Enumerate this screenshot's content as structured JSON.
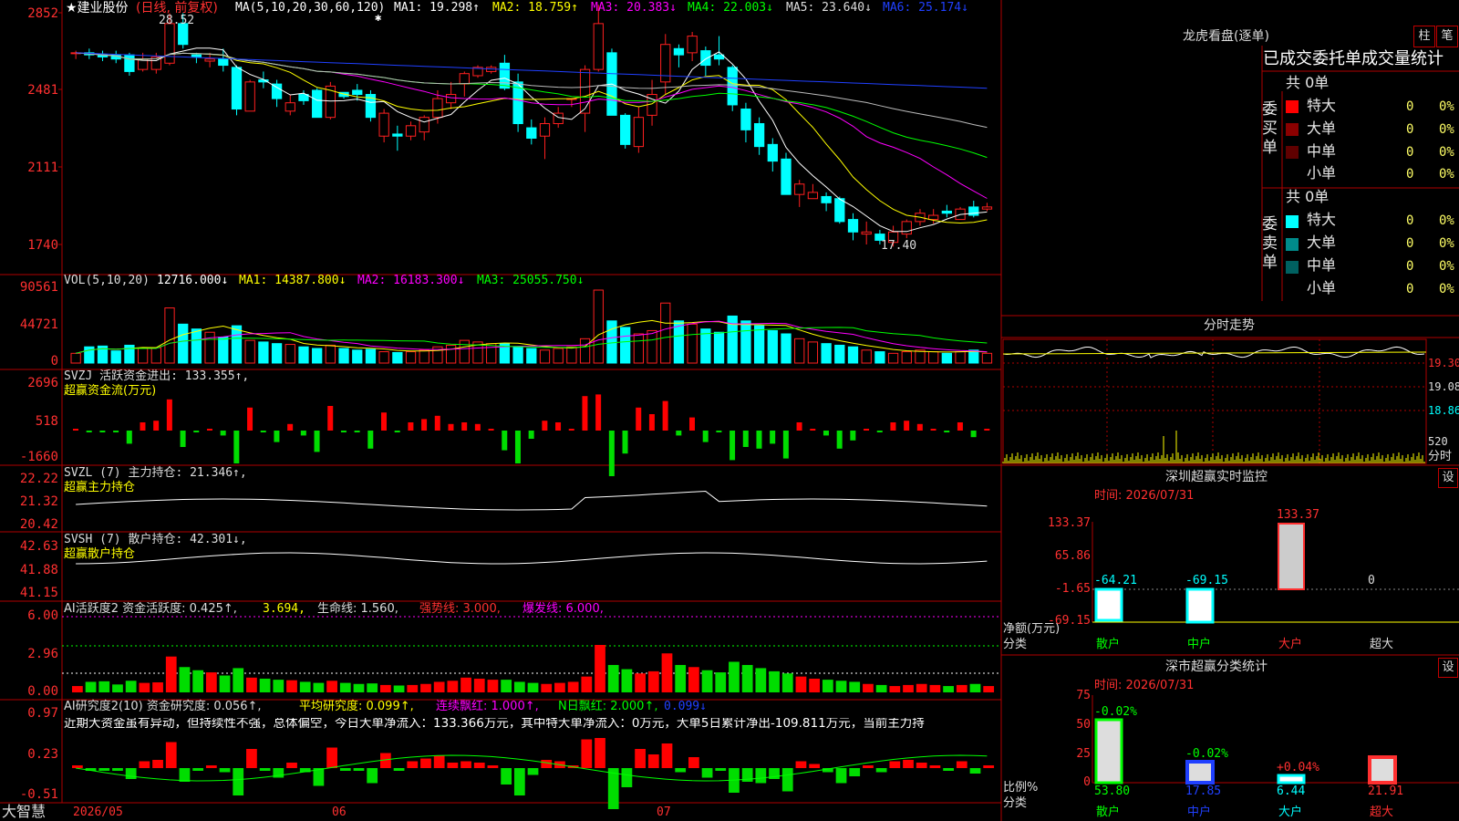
{
  "colors": {
    "up": "#ff2020",
    "down": "#00ffff",
    "ma1": "#ffffff",
    "ma2": "#ffff00",
    "ma3": "#ff00ff",
    "ma4": "#00ff00",
    "ma5": "#bbbbbb",
    "ma6": "#2040ff",
    "grid": "#b00000"
  },
  "header": {
    "title": "★建业股份",
    "mode": "(日线, 前复权)",
    "ma_label": "MA(5,10,20,30,60,120)",
    "ma": [
      "MA1: 19.298↑",
      "MA2: 18.759↑",
      "MA3: 20.383↓",
      "MA4: 22.003↓",
      "MA5: 23.640↓",
      "MA6: 25.174↓"
    ]
  },
  "price_axis": [
    "2852",
    "2481",
    "2111",
    "1740"
  ],
  "price_notes": {
    "high": "28.52",
    "low": "17.40",
    "star": "✱"
  },
  "vol": {
    "label": "VOL(5,10,20)",
    "value": "12716.000↓",
    "ma": [
      "MA1: 14387.800↓",
      "MA2: 16183.300↓",
      "MA3: 25055.750↓"
    ],
    "axis": [
      "90561",
      "44721",
      "0"
    ]
  },
  "svzj": {
    "label": "SVZJ  活跃资金进出: 133.355↑,",
    "sub": "超赢资金流(万元)",
    "axis": [
      "2696",
      "518",
      "-1660"
    ]
  },
  "svzl": {
    "label": "SVZL (7) 主力持仓: 21.346↑,",
    "sub": "超赢主力持仓",
    "axis": [
      "22.22",
      "21.32",
      "20.42"
    ]
  },
  "svsh": {
    "label": "SVSH (7) 散户持仓: 42.301↓,",
    "sub": "超赢散户持仓",
    "axis": [
      "42.63",
      "41.88",
      "41.15"
    ]
  },
  "ai2": {
    "label": "AI活跃度2 资金活跃度: 0.425↑,",
    "v2": "3.694,",
    "life": "生命线: 1.560,",
    "strong": "强势线: 3.000,",
    "burst": "爆发线: 6.000,",
    "axis": [
      "6.00",
      "2.96",
      "0.00"
    ]
  },
  "ai_res": {
    "label": "AI研究度2(10) 资金研究度: 0.056↑,",
    "avg": "平均研究度: 0.099↑,",
    "lianxu": "连续飘红: 1.000↑,",
    "nred": "N日飘红: 2.000↑,",
    "last": "0.099↓",
    "axis": [
      "0.97",
      "0.23",
      "-0.51"
    ],
    "comment": "近期大资金虽有异动，但持续性不强，总体偏空，今日大单净流入：133.366万元，其中特大单净流入：0万元，大单5日累计净出-109.811万元，当前主力持"
  },
  "bottom": {
    "brand": "大智慧",
    "dates": [
      "2026/05",
      "06",
      "07"
    ]
  },
  "chart_data": {
    "type": "candlestick",
    "candles": [
      [
        26.6,
        26.6,
        26.7,
        26.3
      ],
      [
        26.6,
        26.5,
        26.8,
        26.3
      ],
      [
        26.5,
        26.4,
        26.7,
        26.2
      ],
      [
        26.5,
        26.3,
        26.7,
        26.1
      ],
      [
        26.5,
        25.7,
        26.6,
        25.5
      ],
      [
        25.8,
        26.3,
        26.6,
        25.7
      ],
      [
        25.8,
        26.4,
        26.6,
        25.6
      ],
      [
        26.1,
        28.0,
        28.5,
        26.0
      ],
      [
        28.0,
        27.0,
        28.5,
        26.8
      ],
      [
        26.5,
        26.4,
        26.6,
        26.1
      ],
      [
        26.2,
        26.3,
        26.6,
        25.9
      ],
      [
        26.3,
        26.0,
        26.8,
        25.7
      ],
      [
        25.9,
        23.9,
        26.0,
        23.6
      ],
      [
        23.8,
        25.2,
        25.3,
        23.8
      ],
      [
        25.3,
        25.2,
        25.7,
        24.9
      ],
      [
        25.1,
        24.4,
        25.3,
        24.0
      ],
      [
        23.8,
        24.2,
        24.6,
        23.6
      ],
      [
        24.6,
        24.3,
        24.8,
        24.1
      ],
      [
        24.8,
        23.5,
        24.9,
        23.5
      ],
      [
        23.5,
        25.0,
        25.2,
        23.4
      ],
      [
        24.7,
        24.5,
        24.7,
        24.4
      ],
      [
        24.8,
        24.6,
        25.1,
        24.3
      ],
      [
        24.6,
        23.5,
        24.8,
        23.3
      ],
      [
        22.6,
        23.7,
        23.9,
        22.3
      ],
      [
        22.7,
        22.6,
        23.1,
        21.9
      ],
      [
        22.6,
        23.1,
        23.3,
        22.4
      ],
      [
        22.8,
        23.5,
        23.6,
        22.4
      ],
      [
        23.5,
        24.4,
        24.8,
        23.2
      ],
      [
        24.2,
        24.6,
        25.2,
        23.9
      ],
      [
        25.1,
        25.6,
        25.7,
        24.5
      ],
      [
        25.5,
        25.9,
        26.0,
        25.4
      ],
      [
        25.7,
        25.9,
        26.0,
        25.6
      ],
      [
        26.1,
        24.9,
        26.5,
        24.8
      ],
      [
        25.2,
        23.2,
        25.6,
        22.8
      ],
      [
        23.0,
        22.5,
        23.4,
        22.2
      ],
      [
        22.6,
        23.2,
        23.5,
        21.5
      ],
      [
        23.2,
        23.7,
        24.0,
        23.0
      ],
      [
        24.4,
        24.4,
        24.4,
        24.0
      ],
      [
        23.7,
        25.8,
        26.0,
        22.8
      ],
      [
        25.8,
        28.0,
        28.9,
        25.7
      ],
      [
        26.6,
        23.6,
        26.8,
        23.6
      ],
      [
        23.6,
        22.2,
        23.7,
        22.0
      ],
      [
        22.1,
        23.5,
        24.0,
        21.8
      ],
      [
        23.6,
        24.6,
        25.3,
        23.1
      ],
      [
        25.2,
        27.0,
        27.5,
        24.6
      ],
      [
        26.8,
        26.5,
        27.0,
        25.9
      ],
      [
        26.6,
        27.4,
        27.6,
        26.2
      ],
      [
        26.7,
        26.0,
        26.9,
        25.5
      ],
      [
        26.5,
        26.3,
        27.4,
        26.0
      ],
      [
        25.9,
        24.1,
        26.0,
        23.8
      ],
      [
        23.9,
        22.9,
        24.2,
        22.3
      ],
      [
        23.2,
        22.1,
        23.5,
        21.7
      ],
      [
        22.2,
        21.4,
        22.5,
        20.9
      ],
      [
        21.5,
        19.8,
        21.8,
        19.8
      ],
      [
        19.8,
        20.3,
        20.5,
        19.2
      ],
      [
        19.6,
        19.9,
        20.3,
        19.6
      ],
      [
        19.7,
        19.4,
        19.9,
        19.0
      ],
      [
        19.6,
        18.5,
        19.7,
        18.4
      ],
      [
        18.6,
        18.0,
        18.9,
        17.6
      ],
      [
        17.9,
        18.0,
        18.5,
        17.4
      ],
      [
        17.9,
        17.6,
        18.1,
        17.4
      ],
      [
        17.5,
        18.0,
        18.3,
        17.3
      ],
      [
        17.9,
        18.5,
        18.6,
        17.7
      ],
      [
        18.5,
        18.9,
        19.1,
        18.3
      ],
      [
        18.6,
        18.8,
        19.1,
        18.4
      ],
      [
        19.0,
        18.9,
        19.3,
        18.7
      ],
      [
        18.6,
        19.1,
        19.2,
        18.6
      ],
      [
        19.2,
        18.8,
        19.5,
        18.7
      ],
      [
        19.1,
        19.2,
        19.4,
        19.0
      ]
    ],
    "volumes": [
      12,
      20,
      21,
      15,
      22,
      18,
      19,
      68,
      48,
      42,
      38,
      32,
      46,
      28,
      26,
      24,
      23,
      20,
      18,
      22,
      18,
      16,
      17,
      14,
      13,
      14,
      16,
      20,
      22,
      28,
      26,
      24,
      24,
      20,
      18,
      16,
      18,
      20,
      30,
      90,
      52,
      44,
      36,
      40,
      74,
      52,
      48,
      42,
      38,
      58,
      52,
      46,
      40,
      36,
      30,
      26,
      24,
      22,
      20,
      16,
      14,
      12,
      14,
      16,
      14,
      12,
      14,
      16,
      12
    ],
    "ylim": [
      17.4,
      28.52
    ],
    "x_dates": [
      "2026/05",
      "06",
      "07"
    ]
  },
  "right": {
    "lhb_title": "龙虎看盘(逐单)",
    "btn1": "柱",
    "btn2": "笔",
    "stat_title": "已成交委托单成交量统计",
    "buy_total": "共 0单",
    "buy_label": "委买单",
    "sell_total": "共 0单",
    "sell_label": "委卖单",
    "rows": [
      {
        "label": "特大",
        "n": "0",
        "p": "0%"
      },
      {
        "label": "大单",
        "n": "0",
        "p": "0%"
      },
      {
        "label": "中单",
        "n": "0",
        "p": "0%"
      },
      {
        "label": "小单",
        "n": "0",
        "p": "0%"
      }
    ],
    "fenshi_title": "分时走势",
    "fenshi_axis": [
      "19.30",
      "19.08",
      "18.86",
      "520",
      "分时"
    ],
    "sz_title": "深圳超赢实时监控",
    "sz_btn": "设",
    "sz_time": "时间: 2026/07/31",
    "sz_axis": [
      "133.37",
      "65.86",
      "-1.65",
      "-69.15"
    ],
    "sz_vals": [
      "-64.21",
      "-69.15",
      "133.37",
      "0"
    ],
    "sz_cats": [
      "散户",
      "中户",
      "大户",
      "超大"
    ],
    "sz_ylabel": "净额(万元)",
    "sz_xlabel": "分类",
    "cls_title": "深市超赢分类统计",
    "cls_btn": "设",
    "cls_time": "时间: 2026/07/31",
    "cls_axis": [
      "75",
      "50",
      "25",
      "0"
    ],
    "cls_chg": [
      "-0.02%",
      "-0.02%",
      "+0.04%",
      ""
    ],
    "cls_vals": [
      "53.80",
      "17.85",
      "6.44",
      "21.91"
    ],
    "cls_cats": [
      "散户",
      "中户",
      "大户",
      "超大"
    ],
    "cls_ylabel": "比例%",
    "cls_xlabel": "分类"
  }
}
